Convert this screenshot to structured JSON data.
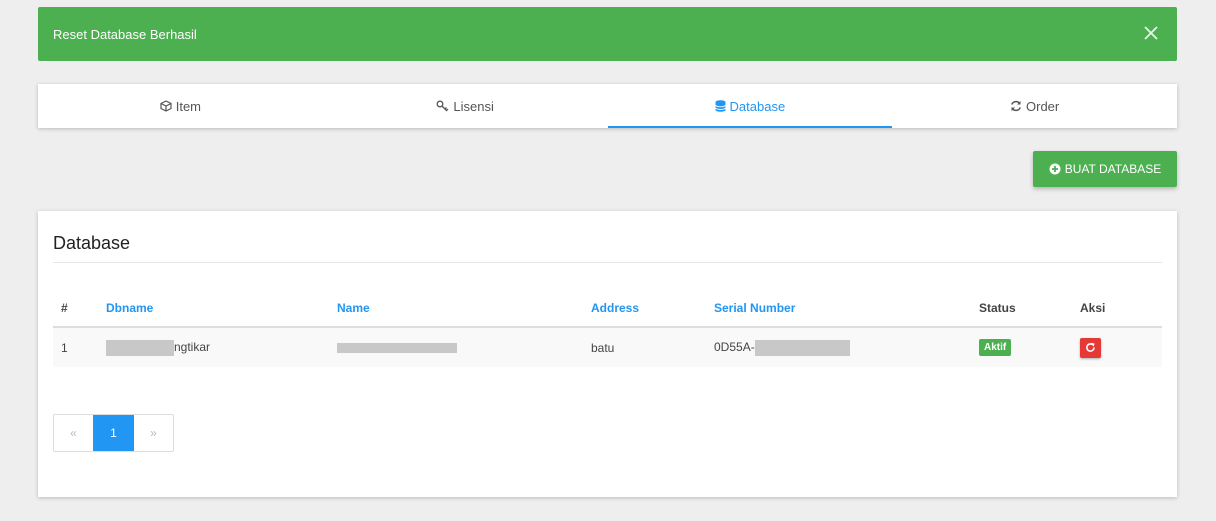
{
  "alert": {
    "message": "Reset Database Berhasil"
  },
  "tabs": [
    {
      "label": "Item",
      "icon": "cube-icon"
    },
    {
      "label": "Lisensi",
      "icon": "key-icon"
    },
    {
      "label": "Database",
      "icon": "database-icon",
      "active": true
    },
    {
      "label": "Order",
      "icon": "refresh-icon"
    }
  ],
  "toolbar": {
    "create_label": "BUAT DATABASE"
  },
  "card": {
    "title": "Database",
    "columns": [
      "#",
      "Dbname",
      "Name",
      "Address",
      "Serial Number",
      "Status",
      "Aksi"
    ],
    "rows": [
      {
        "num": "1",
        "dbname_visible": "ngtikar",
        "address": "batu",
        "serial_visible": "0D55A-",
        "status": "Aktif"
      }
    ]
  },
  "pagination": {
    "prev": "«",
    "current": "1",
    "next": "»"
  },
  "colors": {
    "success": "#4caf50",
    "primary": "#2196f3",
    "danger": "#e53935"
  }
}
